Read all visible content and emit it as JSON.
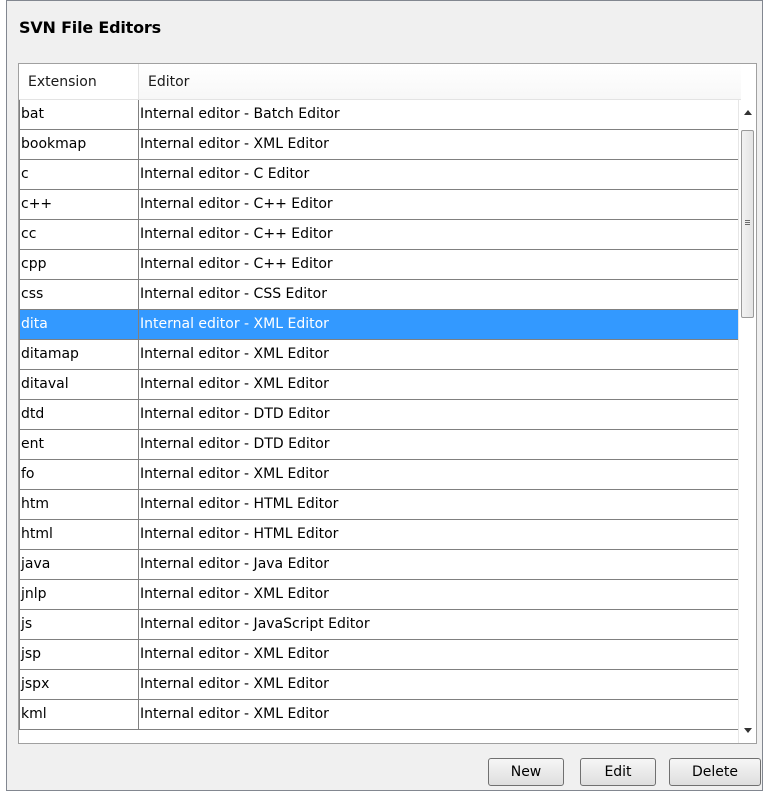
{
  "title": "SVN File Editors",
  "columns": {
    "extension": "Extension",
    "editor": "Editor"
  },
  "rows": [
    {
      "ext": "bat",
      "editor": "Internal editor - Batch Editor"
    },
    {
      "ext": "bookmap",
      "editor": "Internal editor - XML Editor"
    },
    {
      "ext": "c",
      "editor": "Internal editor - C Editor"
    },
    {
      "ext": "c++",
      "editor": "Internal editor - C++ Editor"
    },
    {
      "ext": "cc",
      "editor": "Internal editor - C++ Editor"
    },
    {
      "ext": "cpp",
      "editor": "Internal editor - C++ Editor"
    },
    {
      "ext": "css",
      "editor": "Internal editor - CSS Editor"
    },
    {
      "ext": "dita",
      "editor": "Internal editor - XML Editor",
      "selected": true
    },
    {
      "ext": "ditamap",
      "editor": "Internal editor - XML Editor"
    },
    {
      "ext": "ditaval",
      "editor": "Internal editor - XML Editor"
    },
    {
      "ext": "dtd",
      "editor": "Internal editor - DTD Editor"
    },
    {
      "ext": "ent",
      "editor": "Internal editor - DTD Editor"
    },
    {
      "ext": "fo",
      "editor": "Internal editor - XML Editor"
    },
    {
      "ext": "htm",
      "editor": "Internal editor - HTML Editor"
    },
    {
      "ext": "html",
      "editor": "Internal editor - HTML Editor"
    },
    {
      "ext": "java",
      "editor": "Internal editor - Java Editor"
    },
    {
      "ext": "jnlp",
      "editor": "Internal editor - XML Editor"
    },
    {
      "ext": "js",
      "editor": "Internal editor - JavaScript Editor"
    },
    {
      "ext": "jsp",
      "editor": "Internal editor - XML Editor"
    },
    {
      "ext": "jspx",
      "editor": "Internal editor - XML Editor"
    },
    {
      "ext": "kml",
      "editor": "Internal editor - XML Editor"
    }
  ],
  "buttons": {
    "new": "New",
    "edit": "Edit",
    "delete": "Delete"
  },
  "colors": {
    "selection": "#3399ff",
    "panel": "#f0f0f0"
  },
  "icons": {
    "scroll_up": "scroll-up-arrow-icon",
    "scroll_down": "scroll-down-arrow-icon",
    "grip": "scroll-grip-icon"
  }
}
